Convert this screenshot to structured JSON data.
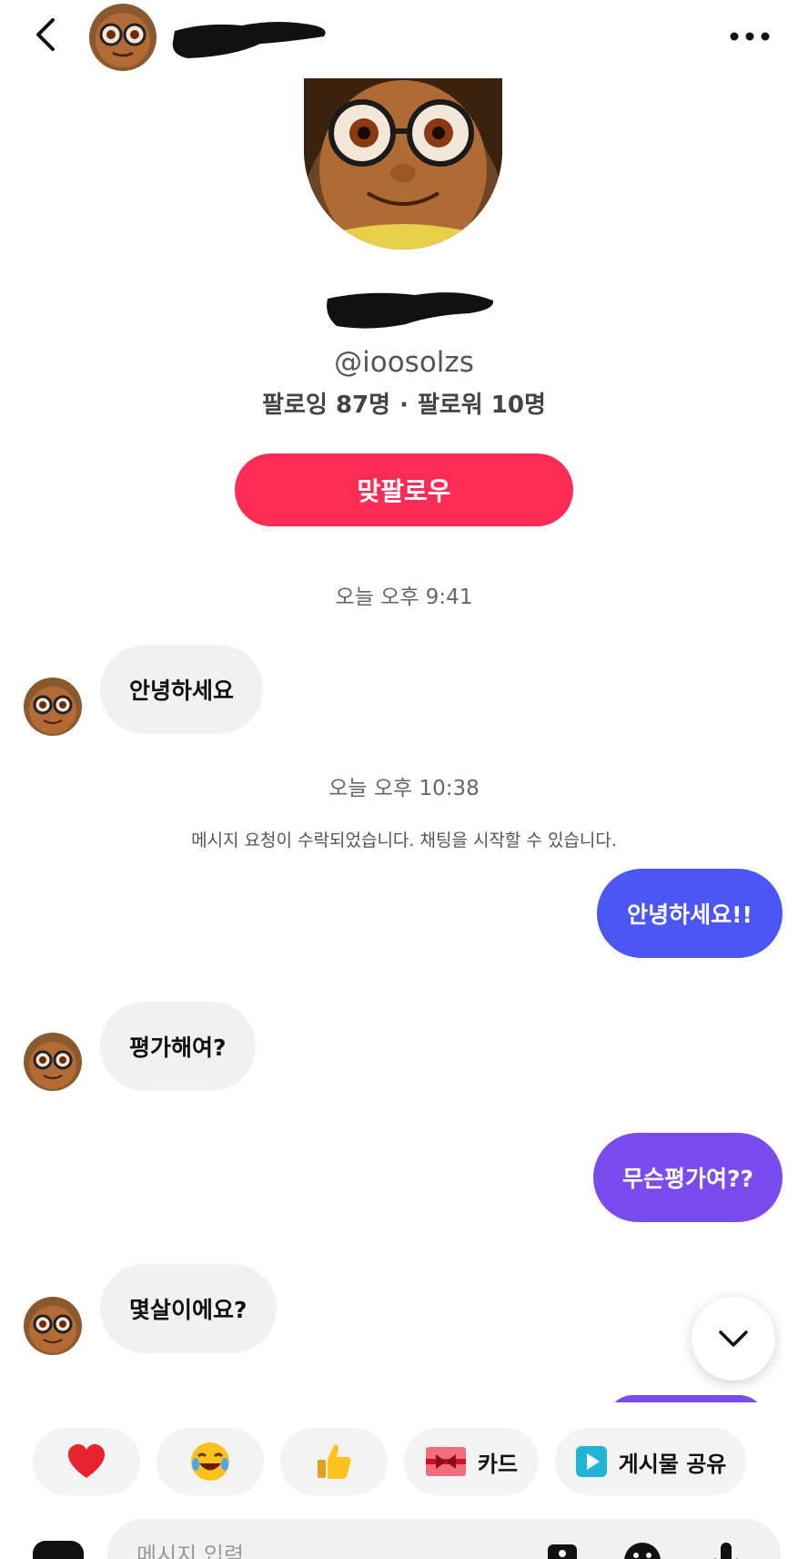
{
  "header": {
    "back_icon": "chevron-left-icon",
    "more_icon": "more-horizontal-icon"
  },
  "profile": {
    "handle": "@ioosolzs",
    "following_label": "팔로잉",
    "following_count": "87명",
    "separator": "·",
    "followers_label": "팔로워",
    "followers_count": "10명",
    "follow_back_label": "맞팔로우"
  },
  "chat": {
    "timestamp_1": "오늘 오후 9:41",
    "msg_in_1": "안녕하세요",
    "timestamp_2": "오늘 오후 10:38",
    "system_notice": "메시지 요청이 수락되었습니다. 채팅을 시작할 수 있습니다.",
    "msg_out_1": "안녕하세요!!",
    "msg_in_2": "평가해여?",
    "msg_out_2": "무슨평가여??",
    "msg_in_3": "몇살이에요?"
  },
  "colors": {
    "follow_button": "#fe2c55",
    "outgoing_bubble_1": "#4c56f5",
    "outgoing_bubble_2": "#7a4cf0",
    "incoming_bubble": "#f1f1f2"
  },
  "quick_replies": [
    {
      "icon": "heart-icon",
      "emoji": "❤️",
      "label": ""
    },
    {
      "icon": "laughing-icon",
      "emoji": "😂",
      "label": ""
    },
    {
      "icon": "thumbs-up-icon",
      "emoji": "👍",
      "label": ""
    },
    {
      "icon": "card-icon",
      "emoji": "",
      "label": "카드"
    },
    {
      "icon": "post-share-icon",
      "emoji": "",
      "label": "게시물 공유"
    }
  ],
  "input": {
    "placeholder": "메시지 입력"
  }
}
